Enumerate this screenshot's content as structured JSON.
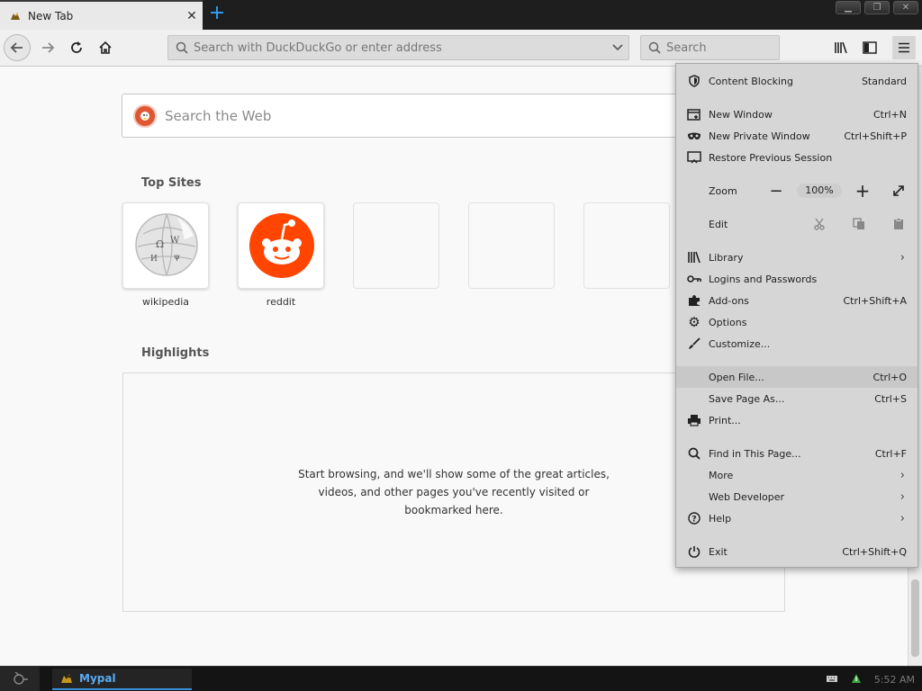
{
  "tab": {
    "title": "New Tab",
    "favicon": "mypal-icon"
  },
  "toolbar": {
    "url_placeholder": "Search with DuckDuckGo or enter address",
    "search_placeholder": "Search"
  },
  "newtab": {
    "search_placeholder": "Search the Web",
    "top_sites_title": "Top Sites",
    "top_sites": [
      {
        "label": "wikipedia",
        "icon": "wikipedia-logo"
      },
      {
        "label": "reddit",
        "icon": "reddit-logo"
      },
      {
        "label": ""
      },
      {
        "label": ""
      },
      {
        "label": ""
      }
    ],
    "highlights_title": "Highlights",
    "highlights_message": "Start browsing, and we'll show some of the great articles, videos, and other pages you've recently visited or bookmarked here."
  },
  "menu": {
    "content_blocking": {
      "label": "Content Blocking",
      "value": "Standard"
    },
    "new_window": {
      "label": "New Window",
      "shortcut": "Ctrl+N"
    },
    "new_private_window": {
      "label": "New Private Window",
      "shortcut": "Ctrl+Shift+P"
    },
    "restore_session": {
      "label": "Restore Previous Session"
    },
    "zoom": {
      "label": "Zoom",
      "level": "100%"
    },
    "edit": {
      "label": "Edit"
    },
    "library": {
      "label": "Library"
    },
    "logins": {
      "label": "Logins and Passwords"
    },
    "addons": {
      "label": "Add-ons",
      "shortcut": "Ctrl+Shift+A"
    },
    "options": {
      "label": "Options"
    },
    "customize": {
      "label": "Customize..."
    },
    "open_file": {
      "label": "Open File...",
      "shortcut": "Ctrl+O"
    },
    "save_page": {
      "label": "Save Page As...",
      "shortcut": "Ctrl+S"
    },
    "print": {
      "label": "Print..."
    },
    "find": {
      "label": "Find in This Page...",
      "shortcut": "Ctrl+F"
    },
    "more": {
      "label": "More"
    },
    "web_developer": {
      "label": "Web Developer"
    },
    "help": {
      "label": "Help"
    },
    "exit": {
      "label": "Exit",
      "shortcut": "Ctrl+Shift+Q"
    }
  },
  "taskbar": {
    "app_label": "Mypal",
    "clock": "5:52 AM"
  },
  "colors": {
    "accent": "#2ea3ff",
    "reddit": "#ff4500",
    "duckduckgo": "#de5833",
    "taskbar_text": "#5aaaf0"
  }
}
